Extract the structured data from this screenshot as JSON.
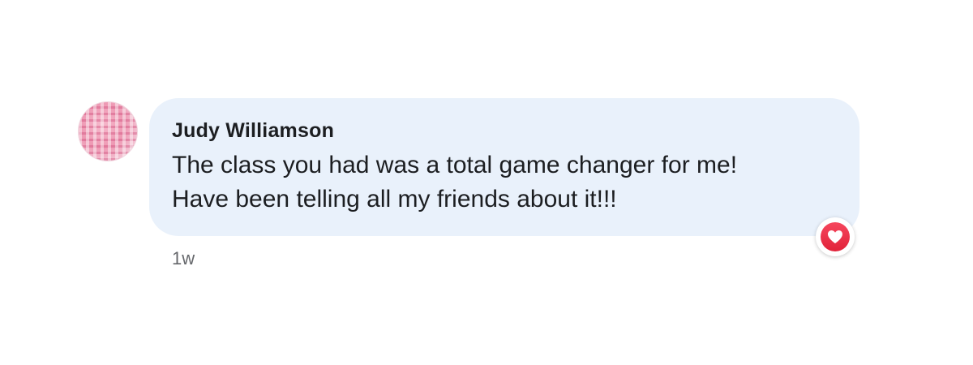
{
  "comment": {
    "author": "Judy Williamson",
    "lines": [
      "The class you had was a total game changer for me!",
      "Have been telling all my friends about it!!!"
    ],
    "timestamp": "1w",
    "reaction_icon": "heart-icon",
    "colors": {
      "bubble": "#e9f1fb",
      "reaction": "#f33e58",
      "text": "#1c1e21",
      "meta": "#65676b"
    }
  }
}
